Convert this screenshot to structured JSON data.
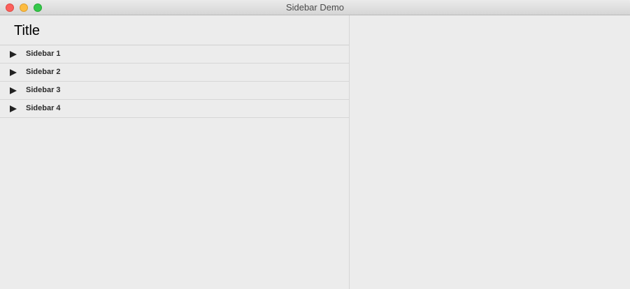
{
  "window": {
    "title": "Sidebar Demo"
  },
  "sidebar": {
    "title": "Title",
    "items": [
      {
        "label": "Sidebar 1",
        "icon": "disclosure-triangle-icon"
      },
      {
        "label": "Sidebar 2",
        "icon": "disclosure-triangle-icon"
      },
      {
        "label": "Sidebar 3",
        "icon": "disclosure-triangle-icon"
      },
      {
        "label": "Sidebar 4",
        "icon": "disclosure-triangle-icon"
      }
    ]
  },
  "colors": {
    "close": "#fc605c",
    "minimize": "#fdbc40",
    "zoom": "#34c84a",
    "background": "#ececec"
  }
}
